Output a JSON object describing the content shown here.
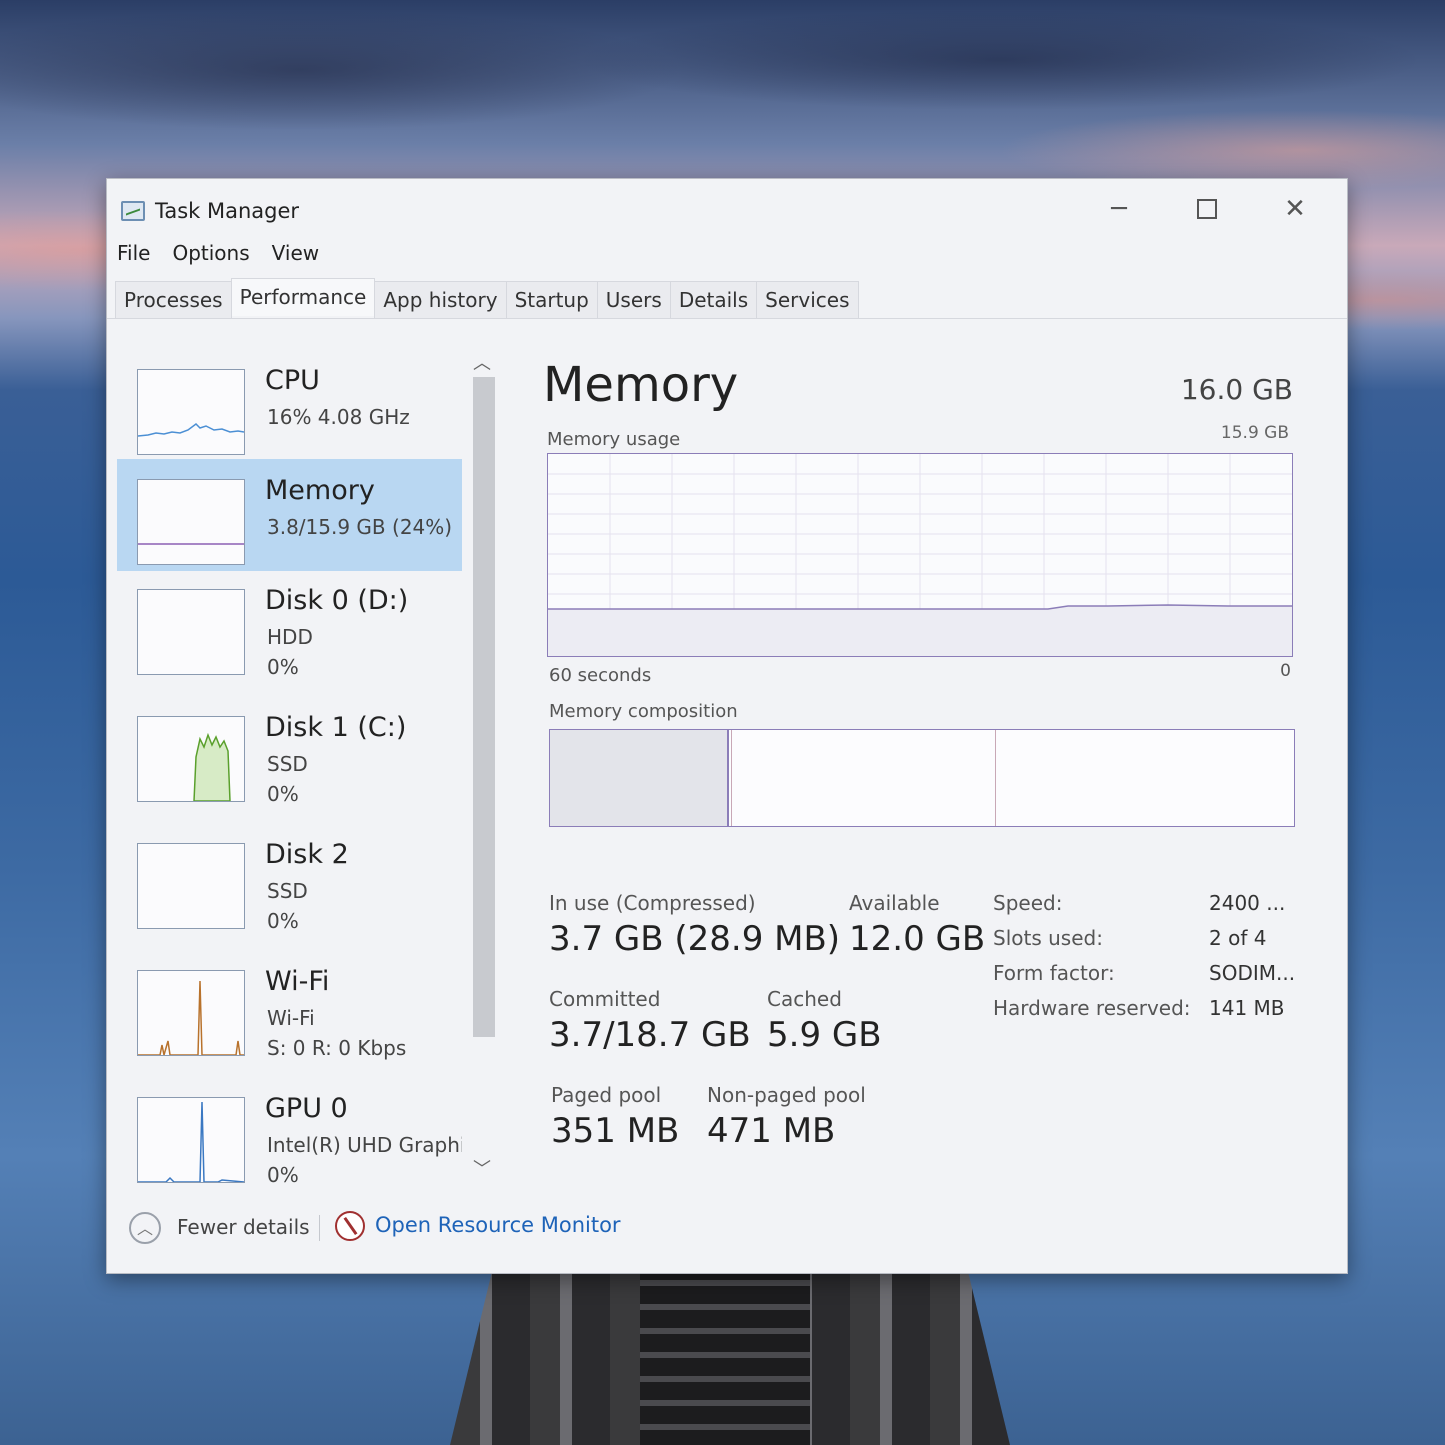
{
  "window": {
    "title": "Task Manager"
  },
  "menu": [
    "File",
    "Options",
    "View"
  ],
  "tabs": [
    {
      "label": "Processes"
    },
    {
      "label": "Performance"
    },
    {
      "label": "App history"
    },
    {
      "label": "Startup"
    },
    {
      "label": "Users"
    },
    {
      "label": "Details"
    },
    {
      "label": "Services"
    }
  ],
  "active_tab": "Performance",
  "sidebar": {
    "items": [
      {
        "name": "CPU",
        "sub1": "16%  4.08 GHz",
        "sub2": "",
        "sub3": ""
      },
      {
        "name": "Memory",
        "sub1": "3.8/15.9 GB (24%)",
        "sub2": "",
        "sub3": ""
      },
      {
        "name": "Disk 0 (D:)",
        "sub1": "HDD",
        "sub2": "0%",
        "sub3": ""
      },
      {
        "name": "Disk 1 (C:)",
        "sub1": "SSD",
        "sub2": "0%",
        "sub3": ""
      },
      {
        "name": "Disk 2",
        "sub1": "SSD",
        "sub2": "0%",
        "sub3": ""
      },
      {
        "name": "Wi-Fi",
        "sub1": "Wi-Fi",
        "sub2": "S: 0 R: 0 Kbps",
        "sub3": ""
      },
      {
        "name": "GPU 0",
        "sub1": "Intel(R) UHD Graphic",
        "sub2": "0%",
        "sub3": ""
      }
    ],
    "selected": "Memory",
    "colors": {
      "cpu": "#4b8fd4",
      "memory": "#8b5fb3",
      "disk": "#5aa02c",
      "wifi": "#b8722c",
      "gpu": "#3a78c2"
    }
  },
  "main": {
    "title": "Memory",
    "total": "16.0 GB",
    "usage_label": "Memory usage",
    "usage_max": "15.9 GB",
    "axis_left": "60 seconds",
    "axis_right": "0",
    "composition_label": "Memory composition",
    "composition": {
      "in_use_fraction": 0.24,
      "modified_fraction": 0.245,
      "standby_fraction": 0.6
    },
    "stats": {
      "in_use_label": "In use (Compressed)",
      "in_use_value": "3.7 GB (28.9 MB)",
      "available_label": "Available",
      "available_value": "12.0 GB",
      "committed_label": "Committed",
      "committed_value": "3.7/18.7 GB",
      "cached_label": "Cached",
      "cached_value": "5.9 GB",
      "paged_label": "Paged pool",
      "paged_value": "351 MB",
      "nonpaged_label": "Non-paged pool",
      "nonpaged_value": "471 MB"
    },
    "details": [
      {
        "label": "Speed:",
        "value": "2400 ..."
      },
      {
        "label": "Slots used:",
        "value": "2 of 4"
      },
      {
        "label": "Form factor:",
        "value": "SODIM..."
      },
      {
        "label": "Hardware reserved:",
        "value": "141 MB"
      }
    ]
  },
  "footer": {
    "fewer_details": "Fewer details",
    "open_resource_monitor": "Open Resource Monitor"
  }
}
